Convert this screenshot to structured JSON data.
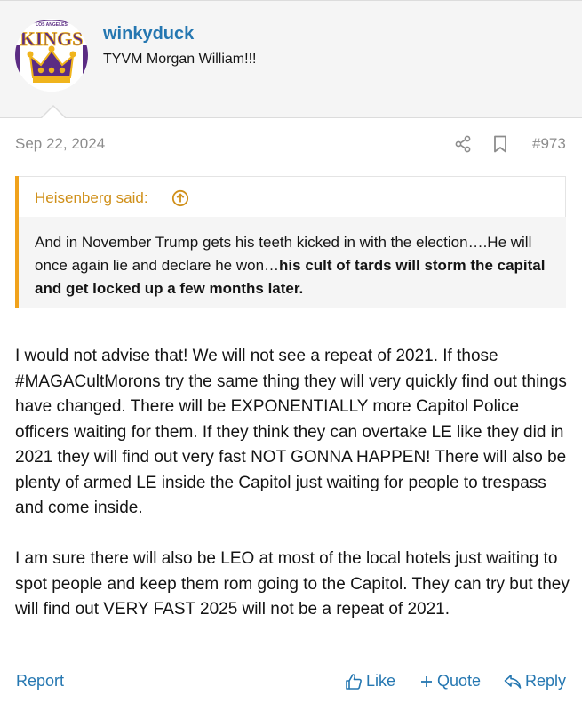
{
  "user": {
    "username": "winkyduck",
    "title": "TYVM Morgan William!!!",
    "avatar": {
      "icon": "kings-crown-logo",
      "arc_text": "LOS ANGELES",
      "word": "KINGS",
      "colors": {
        "purple": "#5b2c83",
        "gold": "#f0b41c"
      }
    }
  },
  "post": {
    "date": "Sep 22, 2024",
    "number": "#973",
    "share_icon": "share-icon",
    "bookmark_icon": "bookmark-icon"
  },
  "quote": {
    "author_label": "Heisenberg said:",
    "text_plain": "And in November Trump gets his teeth kicked in with the election….He will once again lie and declare he won…",
    "text_bold": "his cult of tards will storm the capital and get locked up a few months later."
  },
  "message": {
    "paragraphs": [
      "I would not advise that! We will not see a repeat of 2021. If those #MAGACultMorons try the same thing they will very quickly find out things have changed. There will be EXPONENTIALLY more Capitol Police officers waiting for them. If they think they can overtake LE like they did in 2021 they will find out very fast NOT GONNA HAPPEN! There will also be plenty of armed LE inside the Capitol just waiting for people to trespass and come inside.",
      "I am sure there will also be LEO at most of the local hotels just waiting to spot people and keep them rom going to the Capitol. They can try but they will find out VERY FAST 2025 will not be a repeat of 2021."
    ]
  },
  "actions": {
    "report": "Report",
    "like": "Like",
    "quote": "Quote",
    "reply": "Reply"
  },
  "colors": {
    "link": "#2577b1",
    "quote_accent": "#f0a21c",
    "quote_author": "#d0901a",
    "muted": "#8c8c8c"
  }
}
